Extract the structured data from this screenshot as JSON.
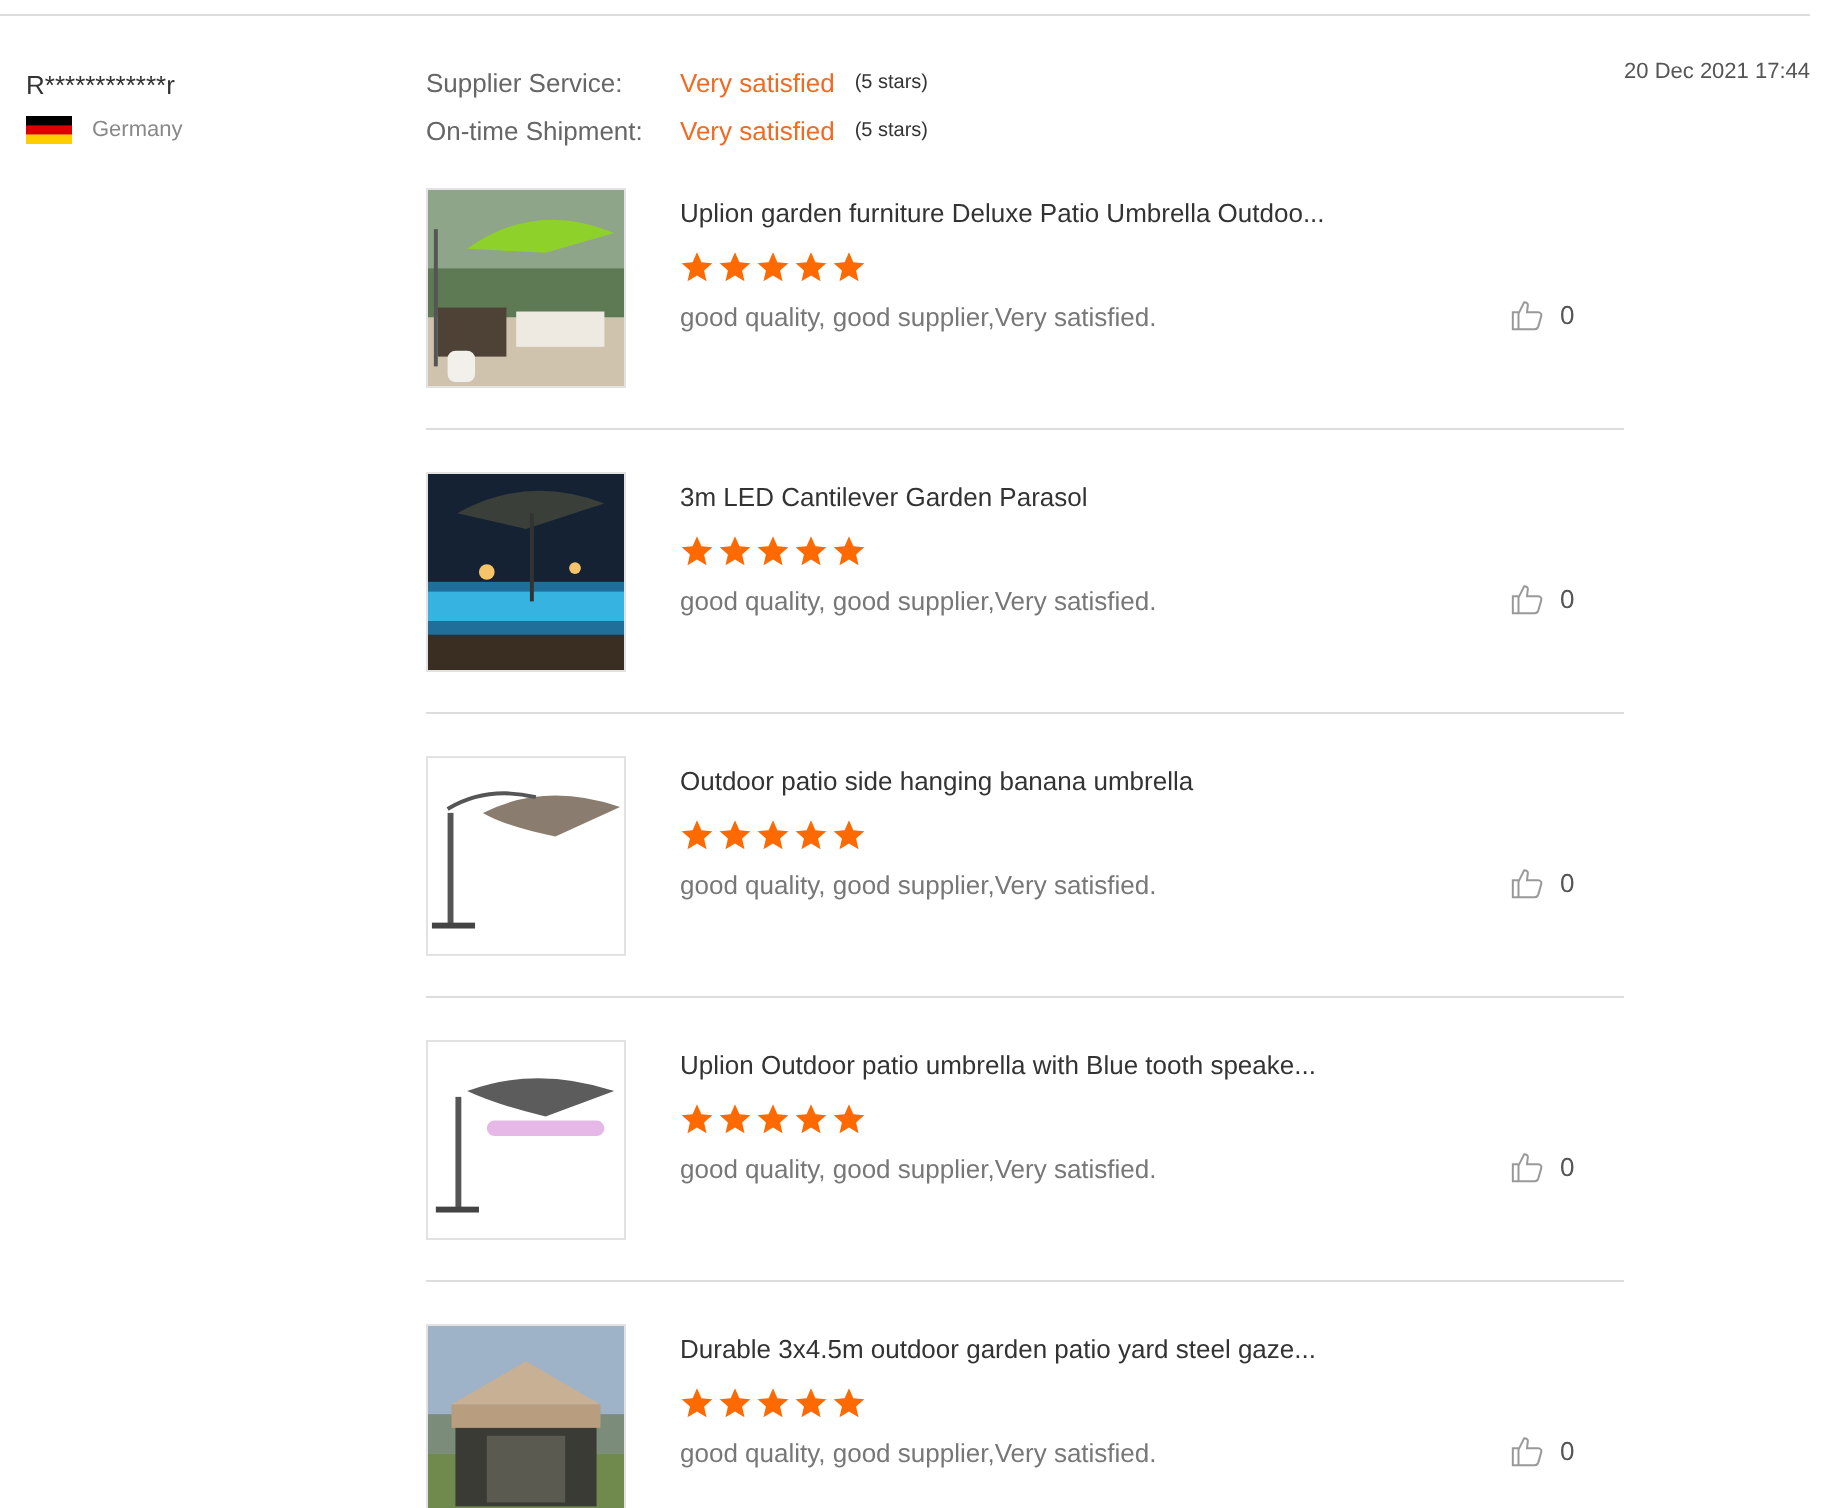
{
  "reviewer": {
    "name": "R************r",
    "country": "Germany"
  },
  "date": "20 Dec 2021 17:44",
  "ratings": [
    {
      "label": "Supplier Service:",
      "value": "Very satisfied",
      "note": "(5 stars)"
    },
    {
      "label": "On-time Shipment:",
      "value": "Very satisfied",
      "note": "(5 stars)"
    }
  ],
  "products": [
    {
      "title": "Uplion garden furniture Deluxe Patio Umbrella Outdoo...",
      "stars": 5,
      "review": "good quality, good supplier,Very satisfied.",
      "likes": "0"
    },
    {
      "title": "3m LED Cantilever Garden Parasol",
      "stars": 5,
      "review": "good quality, good supplier,Very satisfied.",
      "likes": "0"
    },
    {
      "title": "Outdoor patio side hanging banana umbrella",
      "stars": 5,
      "review": "good quality, good supplier,Very satisfied.",
      "likes": "0"
    },
    {
      "title": "Uplion Outdoor patio umbrella with Blue tooth speake...",
      "stars": 5,
      "review": "good quality, good supplier,Very satisfied.",
      "likes": "0"
    },
    {
      "title": "Durable 3x4.5m outdoor garden patio yard steel gaze...",
      "stars": 5,
      "review": "good quality, good supplier,Very satisfied.",
      "likes": "0"
    }
  ]
}
